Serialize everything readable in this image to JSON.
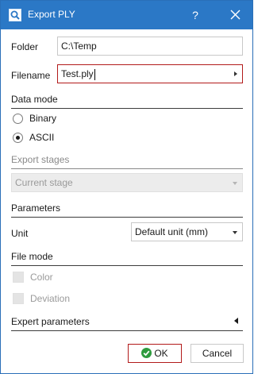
{
  "window": {
    "title": "Export PLY",
    "help_label": "?",
    "app_icon": "magnifier-app-icon",
    "close_icon": "close-icon"
  },
  "folder": {
    "label": "Folder",
    "value": "C:\\Temp"
  },
  "filename": {
    "label": "Filename",
    "value": "Test.ply"
  },
  "data_mode": {
    "title": "Data mode",
    "options": [
      {
        "label": "Binary",
        "selected": false
      },
      {
        "label": "ASCII",
        "selected": true
      }
    ]
  },
  "export_stages": {
    "title": "Export stages",
    "selected": "Current stage",
    "enabled": false
  },
  "parameters": {
    "title": "Parameters",
    "unit_label": "Unit",
    "unit_value": "Default unit (mm)"
  },
  "file_mode": {
    "title": "File mode",
    "options": [
      {
        "label": "Color",
        "checked": false,
        "enabled": false
      },
      {
        "label": "Deviation",
        "checked": false,
        "enabled": false
      }
    ]
  },
  "expert": {
    "title": "Expert parameters",
    "expanded": false
  },
  "buttons": {
    "ok_label": "OK",
    "cancel_label": "Cancel"
  },
  "colors": {
    "titlebar": "#2b78c6",
    "focus_border": "#b21a1a",
    "ok_icon": "#2e9b3e"
  }
}
